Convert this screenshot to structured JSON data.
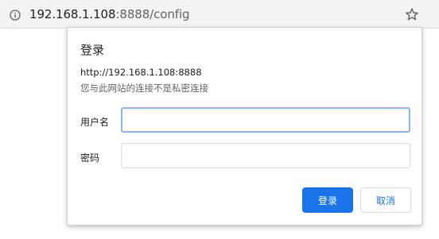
{
  "address_bar": {
    "url_host": "192.168.1.108",
    "url_path": ":8888/config",
    "info_icon": "info-icon",
    "bookmark_icon": "star-icon"
  },
  "auth_dialog": {
    "title": "登录",
    "origin": "http://192.168.1.108:8888",
    "warning": "您与此网站的连接不是私密连接",
    "username_label": "用户名",
    "username_value": "",
    "password_label": "密码",
    "password_value": "",
    "login_button": "登录",
    "cancel_button": "取消"
  },
  "colors": {
    "primary": "#1a73e8",
    "focus_ring": "#8ab4f8",
    "toolbar_bg": "#f1f3f4"
  }
}
